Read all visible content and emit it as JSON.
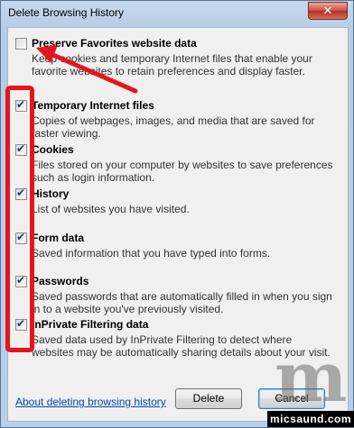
{
  "window": {
    "title": "Delete Browsing History",
    "close_glyph": "✕"
  },
  "options": [
    {
      "label": "Preserve Favorites website data",
      "checked": false,
      "description": "Keep cookies and temporary Internet files that enable your favorite websites to retain preferences and display faster."
    },
    {
      "label": "Temporary Internet files",
      "checked": true,
      "description": "Copies of webpages, images, and media that are saved for faster viewing."
    },
    {
      "label": "Cookies",
      "checked": true,
      "description": "Files stored on your computer by websites to save preferences such as login information."
    },
    {
      "label": "History",
      "checked": true,
      "description": "List of websites you have visited."
    },
    {
      "label": "Form data",
      "checked": true,
      "description": "Saved information that you have typed into forms."
    },
    {
      "label": "Passwords",
      "checked": true,
      "description": "Saved passwords that are automatically filled in when you sign in to a website you've previously visited."
    },
    {
      "label": "InPrivate Filtering data",
      "checked": true,
      "description": "Saved data used by InPrivate Filtering to detect where websites may be automatically sharing details about your visit."
    }
  ],
  "footer": {
    "about_link": "About deleting browsing history",
    "delete_label": "Delete",
    "cancel_label": "Cancel"
  },
  "watermark": {
    "letter": "m",
    "site": "micsaund.com"
  },
  "colors": {
    "highlight_red": "#e8141b",
    "link_blue": "#0645ad"
  }
}
